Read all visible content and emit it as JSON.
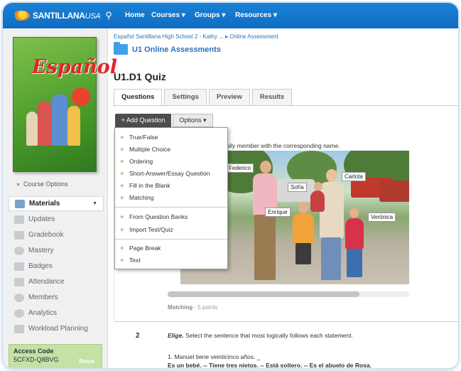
{
  "topbar": {
    "brand": "SANTILLANA",
    "brand_suffix": "USA",
    "nav": [
      "Home",
      "Courses ▾",
      "Groups ▾",
      "Resources ▾"
    ]
  },
  "sidebar": {
    "book_title": "Español",
    "course_options": "Course Options",
    "items": [
      {
        "label": "Materials",
        "icon": "materials-icon"
      },
      {
        "label": "Updates",
        "icon": "updates-icon"
      },
      {
        "label": "Gradebook",
        "icon": "gradebook-icon"
      },
      {
        "label": "Mastery",
        "icon": "mastery-icon"
      },
      {
        "label": "Badges",
        "icon": "badges-icon"
      },
      {
        "label": "Attendance",
        "icon": "attendance-icon"
      },
      {
        "label": "Members",
        "icon": "members-icon"
      },
      {
        "label": "Analytics",
        "icon": "analytics-icon"
      },
      {
        "label": "Workload Planning",
        "icon": "workload-icon"
      }
    ],
    "access_code_label": "Access Code",
    "access_code": "5CFXD-Q8BVG",
    "reset": "Reset"
  },
  "main": {
    "breadcrumb": "Español Santillana High School 2 - Kathy ... ▸ Online Assessment",
    "section_title": "U1 Online Assessments",
    "page_title": "U1.D1 Quiz",
    "tabs": [
      "Questions",
      "Settings",
      "Preview",
      "Results"
    ],
    "add_question": "+ Add Question",
    "options": "Options ▾",
    "menu": {
      "group1": [
        "True/False",
        "Multiple Choice",
        "Ordering",
        "Short-Answer/Essay Question",
        "Fill in the Blank",
        "Matching"
      ],
      "group2": [
        "From Question Banks",
        "Import Test/Quiz"
      ],
      "group3": [
        "Page Break",
        "Text"
      ]
    },
    "q1": {
      "instruction": "h family member with the corresponding name.",
      "names": [
        "Federico",
        "Carlota",
        "Sofía",
        "Enrique",
        "Verónica"
      ],
      "type_label": "Matching",
      "points": "- 5 points"
    },
    "q2": {
      "number": "2",
      "elige": "Elige.",
      "instruction": "Select the sentence that most logically follows each statement.",
      "item": "1. Manuel tiene veinticinco años. _",
      "choices": "Es un bebé. -- Tiene tres nietos. -- Está soltero. -- Es el abuelo de Rosa."
    }
  }
}
